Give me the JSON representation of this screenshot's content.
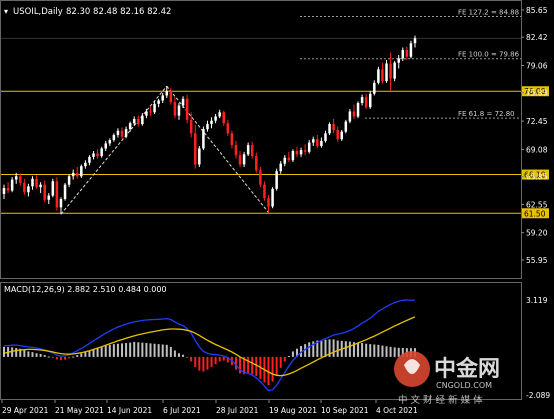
{
  "header": {
    "symbol_timeframe": "USOIL,Daily",
    "ohlc": "82.30 82.48 82.16 82.42"
  },
  "watermark": {
    "logo_text": "中金网",
    "logo_sub": "CNGOLD.COM",
    "slogan": "中 文 财 经 新 媒 体"
  },
  "colors": {
    "background": "#000000",
    "bull": "#ffffff",
    "bear": "#ff2020",
    "horizontal_level": "#e6c200",
    "fib_line": "#9a9a9a",
    "macd_hist": "#c0c0c0",
    "macd_hist_neg": "#ff2020",
    "macd_fast": "#1e3cff",
    "macd_signal": "#e6c200",
    "axis_text": "#ffffff"
  },
  "chart_data": {
    "type": "candlestick",
    "title": "USOIL,Daily",
    "price_axis": {
      "ticks": [
        "85.65",
        "82.42",
        "79.06",
        "75.83",
        "72.45",
        "69.08",
        "65.85",
        "62.55",
        "59.20",
        "55.95"
      ],
      "ylim": [
        55.95,
        85.65
      ]
    },
    "x_tick_labels": [
      "29 Apr 2021",
      "21 May 2021",
      "14 Jun 2021",
      "6 Jul 2021",
      "28 Jul 2021",
      "19 Aug 2021",
      "10 Sep 2021",
      "4 Oct 2021"
    ],
    "levels": [
      {
        "label": "76.00",
        "value": 76.0
      },
      {
        "label": "66.10",
        "value": 66.1
      },
      {
        "label": "61.50",
        "value": 61.5
      }
    ],
    "fibonacci": [
      {
        "label": "FE 127.2 = 84.88",
        "value": 84.88
      },
      {
        "label": "FE 100.0 = 79.86",
        "value": 79.86
      },
      {
        "label": "FE 61.8 = 72.80",
        "value": 72.8
      }
    ],
    "candles": [
      [
        63.8,
        64.9,
        63.2,
        64.5
      ],
      [
        64.5,
        65.2,
        63.9,
        64.2
      ],
      [
        64.2,
        65.8,
        64.0,
        65.5
      ],
      [
        65.5,
        66.3,
        65.0,
        65.9
      ],
      [
        65.9,
        66.2,
        64.8,
        65.1
      ],
      [
        65.1,
        65.6,
        63.7,
        64.0
      ],
      [
        64.0,
        65.0,
        63.5,
        64.7
      ],
      [
        64.7,
        65.9,
        64.3,
        65.6
      ],
      [
        65.6,
        66.0,
        64.4,
        64.6
      ],
      [
        64.6,
        65.2,
        63.9,
        64.9
      ],
      [
        64.9,
        65.4,
        62.8,
        63.1
      ],
      [
        63.1,
        63.9,
        62.6,
        63.6
      ],
      [
        63.6,
        65.6,
        63.4,
        65.3
      ],
      [
        65.3,
        65.8,
        61.8,
        62.2
      ],
      [
        62.2,
        63.4,
        61.4,
        63.2
      ],
      [
        63.2,
        65.1,
        63.0,
        64.9
      ],
      [
        64.9,
        66.1,
        64.6,
        65.9
      ],
      [
        65.9,
        66.7,
        65.5,
        66.3
      ],
      [
        66.3,
        67.0,
        65.6,
        65.9
      ],
      [
        65.9,
        67.3,
        65.7,
        67.1
      ],
      [
        67.1,
        67.8,
        66.8,
        67.5
      ],
      [
        67.5,
        68.4,
        67.2,
        68.2
      ],
      [
        68.2,
        68.9,
        67.9,
        68.6
      ],
      [
        68.6,
        69.1,
        68.0,
        68.3
      ],
      [
        68.3,
        69.4,
        68.1,
        69.2
      ],
      [
        69.2,
        70.1,
        68.9,
        69.8
      ],
      [
        69.8,
        70.4,
        69.5,
        70.2
      ],
      [
        70.2,
        71.0,
        70.0,
        70.8
      ],
      [
        70.8,
        71.6,
        70.5,
        71.3
      ],
      [
        71.3,
        71.7,
        70.3,
        70.6
      ],
      [
        70.6,
        71.8,
        70.4,
        71.5
      ],
      [
        71.5,
        72.4,
        71.2,
        72.2
      ],
      [
        72.2,
        73.0,
        71.9,
        72.7
      ],
      [
        72.7,
        73.1,
        71.8,
        72.1
      ],
      [
        72.1,
        73.4,
        71.9,
        73.1
      ],
      [
        73.1,
        73.9,
        72.8,
        73.6
      ],
      [
        73.6,
        74.2,
        73.1,
        73.5
      ],
      [
        73.5,
        74.8,
        73.3,
        74.5
      ],
      [
        74.5,
        75.1,
        74.1,
        74.9
      ],
      [
        74.9,
        75.8,
        74.6,
        75.5
      ],
      [
        75.5,
        76.6,
        75.2,
        76.0
      ],
      [
        76.0,
        76.4,
        74.4,
        74.7
      ],
      [
        74.7,
        75.3,
        72.8,
        73.1
      ],
      [
        73.1,
        74.6,
        72.6,
        74.3
      ],
      [
        74.3,
        75.4,
        74.0,
        75.1
      ],
      [
        75.1,
        75.6,
        72.2,
        72.6
      ],
      [
        72.6,
        73.5,
        70.5,
        71.0
      ],
      [
        71.0,
        72.0,
        66.8,
        67.3
      ],
      [
        67.3,
        69.5,
        67.0,
        69.2
      ],
      [
        69.2,
        71.8,
        69.0,
        71.5
      ],
      [
        71.5,
        72.5,
        71.2,
        72.1
      ],
      [
        72.1,
        72.9,
        71.6,
        72.5
      ],
      [
        72.5,
        73.3,
        72.2,
        73.0
      ],
      [
        73.0,
        73.8,
        72.8,
        73.5
      ],
      [
        73.5,
        73.7,
        71.9,
        72.2
      ],
      [
        72.2,
        72.6,
        70.7,
        71.0
      ],
      [
        71.0,
        71.3,
        69.2,
        69.6
      ],
      [
        69.6,
        70.1,
        68.0,
        68.4
      ],
      [
        68.4,
        68.9,
        67.0,
        67.3
      ],
      [
        67.3,
        68.8,
        67.0,
        68.5
      ],
      [
        68.5,
        69.9,
        68.3,
        69.6
      ],
      [
        69.6,
        70.0,
        68.0,
        68.3
      ],
      [
        68.3,
        68.7,
        66.3,
        66.6
      ],
      [
        66.6,
        67.0,
        64.6,
        64.9
      ],
      [
        64.9,
        65.3,
        63.0,
        63.3
      ],
      [
        63.3,
        63.7,
        61.6,
        62.3
      ],
      [
        62.3,
        64.6,
        62.1,
        64.4
      ],
      [
        64.4,
        66.8,
        64.2,
        66.5
      ],
      [
        66.5,
        67.7,
        66.2,
        67.4
      ],
      [
        67.4,
        68.4,
        67.1,
        68.1
      ],
      [
        68.1,
        68.8,
        67.6,
        67.8
      ],
      [
        67.8,
        69.1,
        67.6,
        68.9
      ],
      [
        68.9,
        69.4,
        68.2,
        68.5
      ],
      [
        68.5,
        69.3,
        68.2,
        69.0
      ],
      [
        69.0,
        69.7,
        68.4,
        68.8
      ],
      [
        68.8,
        70.2,
        68.6,
        69.9
      ],
      [
        69.9,
        70.6,
        69.5,
        70.3
      ],
      [
        70.3,
        70.8,
        69.2,
        69.5
      ],
      [
        69.5,
        70.5,
        69.3,
        70.1
      ],
      [
        70.1,
        71.3,
        69.9,
        71.0
      ],
      [
        71.0,
        72.3,
        70.8,
        72.1
      ],
      [
        72.1,
        72.7,
        71.0,
        71.4
      ],
      [
        71.4,
        71.8,
        70.0,
        70.3
      ],
      [
        70.3,
        71.4,
        70.1,
        71.2
      ],
      [
        71.2,
        72.6,
        71.0,
        72.4
      ],
      [
        72.4,
        73.9,
        72.2,
        73.6
      ],
      [
        73.6,
        74.4,
        72.7,
        73.0
      ],
      [
        73.0,
        74.8,
        72.8,
        74.6
      ],
      [
        74.6,
        75.6,
        74.3,
        75.3
      ],
      [
        75.3,
        75.7,
        73.9,
        74.1
      ],
      [
        74.1,
        76.0,
        73.9,
        75.7
      ],
      [
        75.7,
        77.3,
        75.5,
        77.0
      ],
      [
        77.0,
        78.9,
        76.8,
        78.6
      ],
      [
        78.6,
        79.4,
        76.9,
        77.2
      ],
      [
        77.2,
        79.7,
        77.0,
        79.3
      ],
      [
        79.3,
        80.6,
        76.1,
        77.5
      ],
      [
        77.5,
        79.6,
        77.2,
        79.4
      ],
      [
        79.4,
        80.3,
        78.7,
        79.9
      ],
      [
        79.9,
        81.2,
        79.6,
        80.9
      ],
      [
        80.9,
        81.3,
        79.7,
        80.1
      ],
      [
        80.1,
        82.0,
        79.9,
        81.7
      ],
      [
        81.7,
        82.6,
        81.2,
        82.3
      ]
    ],
    "macd": {
      "label": "MACD(12,26,9) 2.882 2.510 0.484 0.000",
      "axis_ticks": [
        "3.119",
        "-2.089"
      ],
      "ylim": [
        -2.089,
        3.119
      ],
      "histogram": [
        0.55,
        0.54,
        0.52,
        0.49,
        0.45,
        0.38,
        0.3,
        0.26,
        0.2,
        0.16,
        0.1,
        0.02,
        -0.05,
        -0.14,
        -0.18,
        -0.15,
        -0.08,
        0.02,
        0.1,
        0.18,
        0.26,
        0.34,
        0.42,
        0.5,
        0.56,
        0.62,
        0.66,
        0.7,
        0.72,
        0.74,
        0.76,
        0.78,
        0.82,
        0.8,
        0.78,
        0.76,
        0.74,
        0.72,
        0.7,
        0.68,
        0.66,
        0.55,
        0.35,
        0.2,
        0.12,
        -0.05,
        -0.25,
        -0.55,
        -0.75,
        -0.8,
        -0.7,
        -0.55,
        -0.4,
        -0.25,
        -0.2,
        -0.3,
        -0.45,
        -0.7,
        -0.9,
        -0.95,
        -0.9,
        -0.95,
        -1.05,
        -1.2,
        -1.4,
        -1.55,
        -1.35,
        -1.0,
        -0.6,
        -0.25,
        0.05,
        0.3,
        0.45,
        0.6,
        0.7,
        0.8,
        0.85,
        0.9,
        0.92,
        0.94,
        0.96,
        0.96,
        0.9,
        0.88,
        0.86,
        0.84,
        0.8,
        0.78,
        0.76,
        0.72,
        0.7,
        0.68,
        0.66,
        0.62,
        0.58,
        0.55,
        0.52,
        0.5,
        0.49,
        0.48,
        0.48,
        0.48
      ],
      "fast": [
        0.6,
        0.62,
        0.64,
        0.64,
        0.62,
        0.58,
        0.54,
        0.52,
        0.48,
        0.44,
        0.38,
        0.3,
        0.22,
        0.1,
        0.05,
        0.06,
        0.12,
        0.22,
        0.34,
        0.46,
        0.6,
        0.74,
        0.88,
        1.02,
        1.16,
        1.3,
        1.42,
        1.54,
        1.64,
        1.72,
        1.8,
        1.86,
        1.92,
        1.96,
        2.0,
        2.02,
        2.04,
        2.05,
        2.06,
        2.08,
        2.1,
        2.05,
        1.92,
        1.8,
        1.72,
        1.55,
        1.3,
        0.9,
        0.55,
        0.3,
        0.2,
        0.15,
        0.12,
        0.1,
        0.05,
        -0.05,
        -0.2,
        -0.45,
        -0.7,
        -0.85,
        -0.9,
        -1.0,
        -1.15,
        -1.35,
        -1.6,
        -1.85,
        -1.8,
        -1.55,
        -1.2,
        -0.85,
        -0.5,
        -0.2,
        0.05,
        0.25,
        0.4,
        0.55,
        0.68,
        0.8,
        0.9,
        1.0,
        1.1,
        1.2,
        1.25,
        1.3,
        1.36,
        1.45,
        1.56,
        1.7,
        1.85,
        1.98,
        2.12,
        2.3,
        2.5,
        2.62,
        2.76,
        2.88,
        2.98,
        3.05,
        3.1,
        3.12,
        3.1,
        3.12
      ],
      "signal": [
        0.2,
        0.25,
        0.3,
        0.35,
        0.38,
        0.4,
        0.41,
        0.41,
        0.4,
        0.38,
        0.35,
        0.31,
        0.27,
        0.22,
        0.18,
        0.16,
        0.15,
        0.16,
        0.19,
        0.23,
        0.28,
        0.34,
        0.41,
        0.48,
        0.56,
        0.64,
        0.72,
        0.8,
        0.88,
        0.95,
        1.02,
        1.09,
        1.15,
        1.21,
        1.26,
        1.31,
        1.36,
        1.4,
        1.44,
        1.48,
        1.51,
        1.53,
        1.53,
        1.52,
        1.5,
        1.46,
        1.4,
        1.3,
        1.18,
        1.04,
        0.91,
        0.79,
        0.68,
        0.58,
        0.48,
        0.38,
        0.27,
        0.14,
        0.0,
        -0.12,
        -0.23,
        -0.34,
        -0.45,
        -0.57,
        -0.7,
        -0.83,
        -0.94,
        -1.01,
        -1.03,
        -1.0,
        -0.94,
        -0.85,
        -0.74,
        -0.62,
        -0.51,
        -0.4,
        -0.28,
        -0.16,
        -0.05,
        0.06,
        0.16,
        0.26,
        0.35,
        0.43,
        0.51,
        0.59,
        0.67,
        0.76,
        0.85,
        0.94,
        1.04,
        1.14,
        1.25,
        1.36,
        1.47,
        1.58,
        1.7,
        1.8,
        1.9,
        2.0,
        2.1,
        2.2
      ]
    }
  }
}
